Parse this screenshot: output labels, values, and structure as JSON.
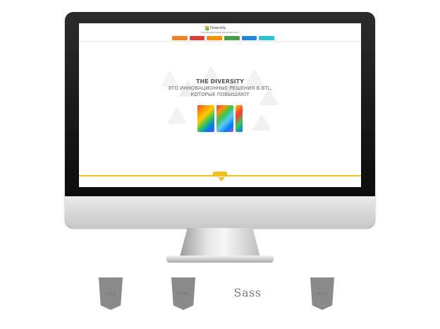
{
  "window": {
    "site_tagline": "ИННОВАЦИОННЫЕ РЕШЕНИЯ В BTL",
    "logo_text": "Diversity",
    "nav_tabs": [
      {
        "label": "",
        "color": "#f58220"
      },
      {
        "label": "",
        "color": "#e53935"
      },
      {
        "label": "",
        "color": "#ff8f00"
      },
      {
        "label": "",
        "color": "#43a047"
      },
      {
        "label": "",
        "color": "#1e88e5"
      },
      {
        "label": "",
        "color": "#26c6da"
      }
    ]
  },
  "hero": {
    "title": "THE DIVERSITY",
    "subtitle_line1": "ЭТО ИННОВАЦИОННЫЕ РЕШЕНИЯ В BTL,",
    "subtitle_line2": "КОТОРЫЕ ПОВЫШАЮТ",
    "roi_label": "ROI"
  },
  "footer_tech_icons": [
    {
      "name": "css3-icon",
      "label": "CSS"
    },
    {
      "name": "html5-icon",
      "label": "HTML"
    },
    {
      "name": "sass-icon",
      "label": "Sass"
    },
    {
      "name": "svg-icon",
      "label": "SVG"
    }
  ],
  "colors": {
    "accent": "#f0c020",
    "monitor_bezel": "#111111",
    "chin": "#d9d9d9"
  }
}
